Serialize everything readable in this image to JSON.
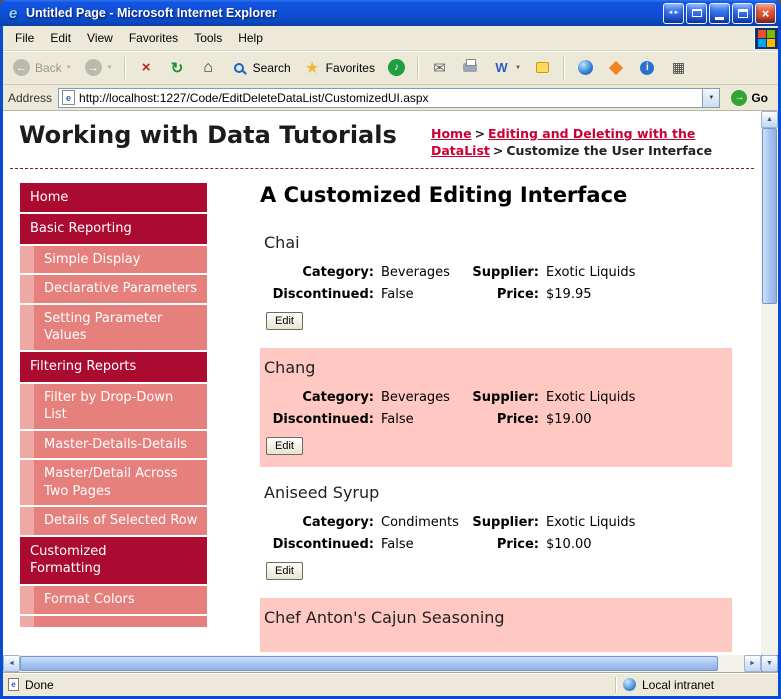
{
  "window": {
    "title": "Untitled Page - Microsoft Internet Explorer",
    "status_left": "Done",
    "status_right": "Local intranet"
  },
  "menu": {
    "items": [
      "File",
      "Edit",
      "View",
      "Favorites",
      "Tools",
      "Help"
    ]
  },
  "toolbar": {
    "back_label": "Back",
    "search_label": "Search",
    "favorites_label": "Favorites"
  },
  "address": {
    "label": "Address",
    "value": "http://localhost:1227/Code/EditDeleteDataList/CustomizedUI.aspx",
    "go_label": "Go"
  },
  "header": {
    "site_title": "Working with Data Tutorials",
    "breadcrumb": {
      "home": "Home",
      "separator": ">",
      "section": "Editing and Deleting with the DataList",
      "current": "Customize the User Interface"
    }
  },
  "sidebar": {
    "items": [
      {
        "label": "Home",
        "type": "header"
      },
      {
        "label": "Basic Reporting",
        "type": "header"
      },
      {
        "label": "Simple Display",
        "type": "item"
      },
      {
        "label": "Declarative Parameters",
        "type": "item"
      },
      {
        "label": "Setting Parameter Values",
        "type": "item"
      },
      {
        "label": "Filtering Reports",
        "type": "header"
      },
      {
        "label": "Filter by Drop-Down List",
        "type": "item"
      },
      {
        "label": "Master-Details-Details",
        "type": "item"
      },
      {
        "label": "Master/Detail Across Two Pages",
        "type": "item"
      },
      {
        "label": "Details of Selected Row",
        "type": "item"
      },
      {
        "label": "Customized Formatting",
        "type": "header"
      },
      {
        "label": "Format Colors",
        "type": "item"
      },
      {
        "label": "",
        "type": "item",
        "partial": true
      }
    ]
  },
  "main": {
    "title": "A Customized Editing Interface",
    "labels": {
      "category": "Category:",
      "supplier": "Supplier:",
      "discontinued": "Discontinued:",
      "price": "Price:",
      "edit": "Edit"
    },
    "products": [
      {
        "name": "Chai",
        "category": "Beverages",
        "supplier": "Exotic Liquids",
        "discontinued": "False",
        "price": "$19.95",
        "alt": false
      },
      {
        "name": "Chang",
        "category": "Beverages",
        "supplier": "Exotic Liquids",
        "discontinued": "False",
        "price": "$19.00",
        "alt": true
      },
      {
        "name": "Aniseed Syrup",
        "category": "Condiments",
        "supplier": "Exotic Liquids",
        "discontinued": "False",
        "price": "$10.00",
        "alt": false
      },
      {
        "name": "Chef Anton's Cajun Seasoning",
        "alt": true,
        "partial": true
      }
    ]
  },
  "icons": {
    "back_arrow": "←",
    "forward_arrow": "→",
    "dropdown": "▼",
    "stop": "×",
    "refresh": "↻",
    "home": "⌂",
    "favorites_star": "★",
    "media_note": "♪",
    "mail": "✉",
    "edit_w": "W",
    "grid": "▦",
    "info": "i",
    "go_arrow": "→",
    "close": "×",
    "title_arrows": "◄►",
    "scroll_up": "▲",
    "scroll_down": "▼",
    "scroll_left": "◄",
    "scroll_right": "►",
    "page_e": "e",
    "ie_e": "e"
  },
  "colors": {
    "titlebar_blue": "#0B4FD6",
    "chrome_beige": "#ECE9D8",
    "nav_header": "#AB0B31",
    "nav_item": "#E5807C",
    "nav_strip": "#EFA9A4",
    "alt_row_pink": "#FFC8C2",
    "accent_link_red": "#CC0033"
  }
}
